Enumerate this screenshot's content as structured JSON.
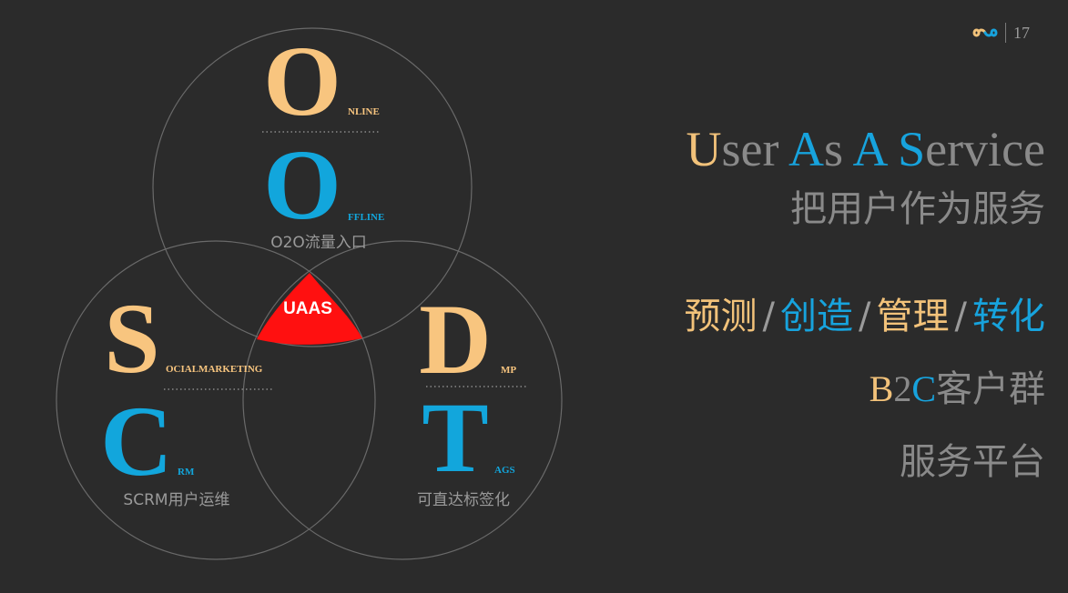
{
  "header": {
    "page_number": "17",
    "logo_icon": "infinity-logo-icon"
  },
  "diagram": {
    "center_label": "UAAS",
    "online": {
      "letter": "O",
      "rest": "NLINE"
    },
    "offline": {
      "letter": "O",
      "rest": "FFLINE"
    },
    "o2o_caption": "O2O流量入口",
    "social": {
      "letter": "S",
      "rest": "OCIALMARKETING"
    },
    "crm": {
      "letter": "C",
      "rest": "RM"
    },
    "scrm_caption": "SCRM用户运维",
    "dmp": {
      "letter": "D",
      "rest": "MP"
    },
    "tags": {
      "letter": "T",
      "rest": "AGS"
    },
    "tags_caption": "可直达标签化",
    "colors": {
      "orange": "#f8c57f",
      "blue": "#12a6dc",
      "red": "#ff1010",
      "circle_stroke": "#6a6a6a"
    }
  },
  "tagline": {
    "u": "U",
    "ser": "ser ",
    "a1": "A",
    "s1": "s ",
    "a2": "A",
    "space": " ",
    "s2": "S",
    "ervice": "ervice"
  },
  "subtitle": "把用户作为服务",
  "actions": {
    "a1": "预测",
    "a2": "创造",
    "a3": "管理",
    "a4": "转化",
    "sep": "/"
  },
  "b2c": {
    "b": "B",
    "two": "2",
    "c": "C",
    "rest": "客户群"
  },
  "platform": "服务平台"
}
